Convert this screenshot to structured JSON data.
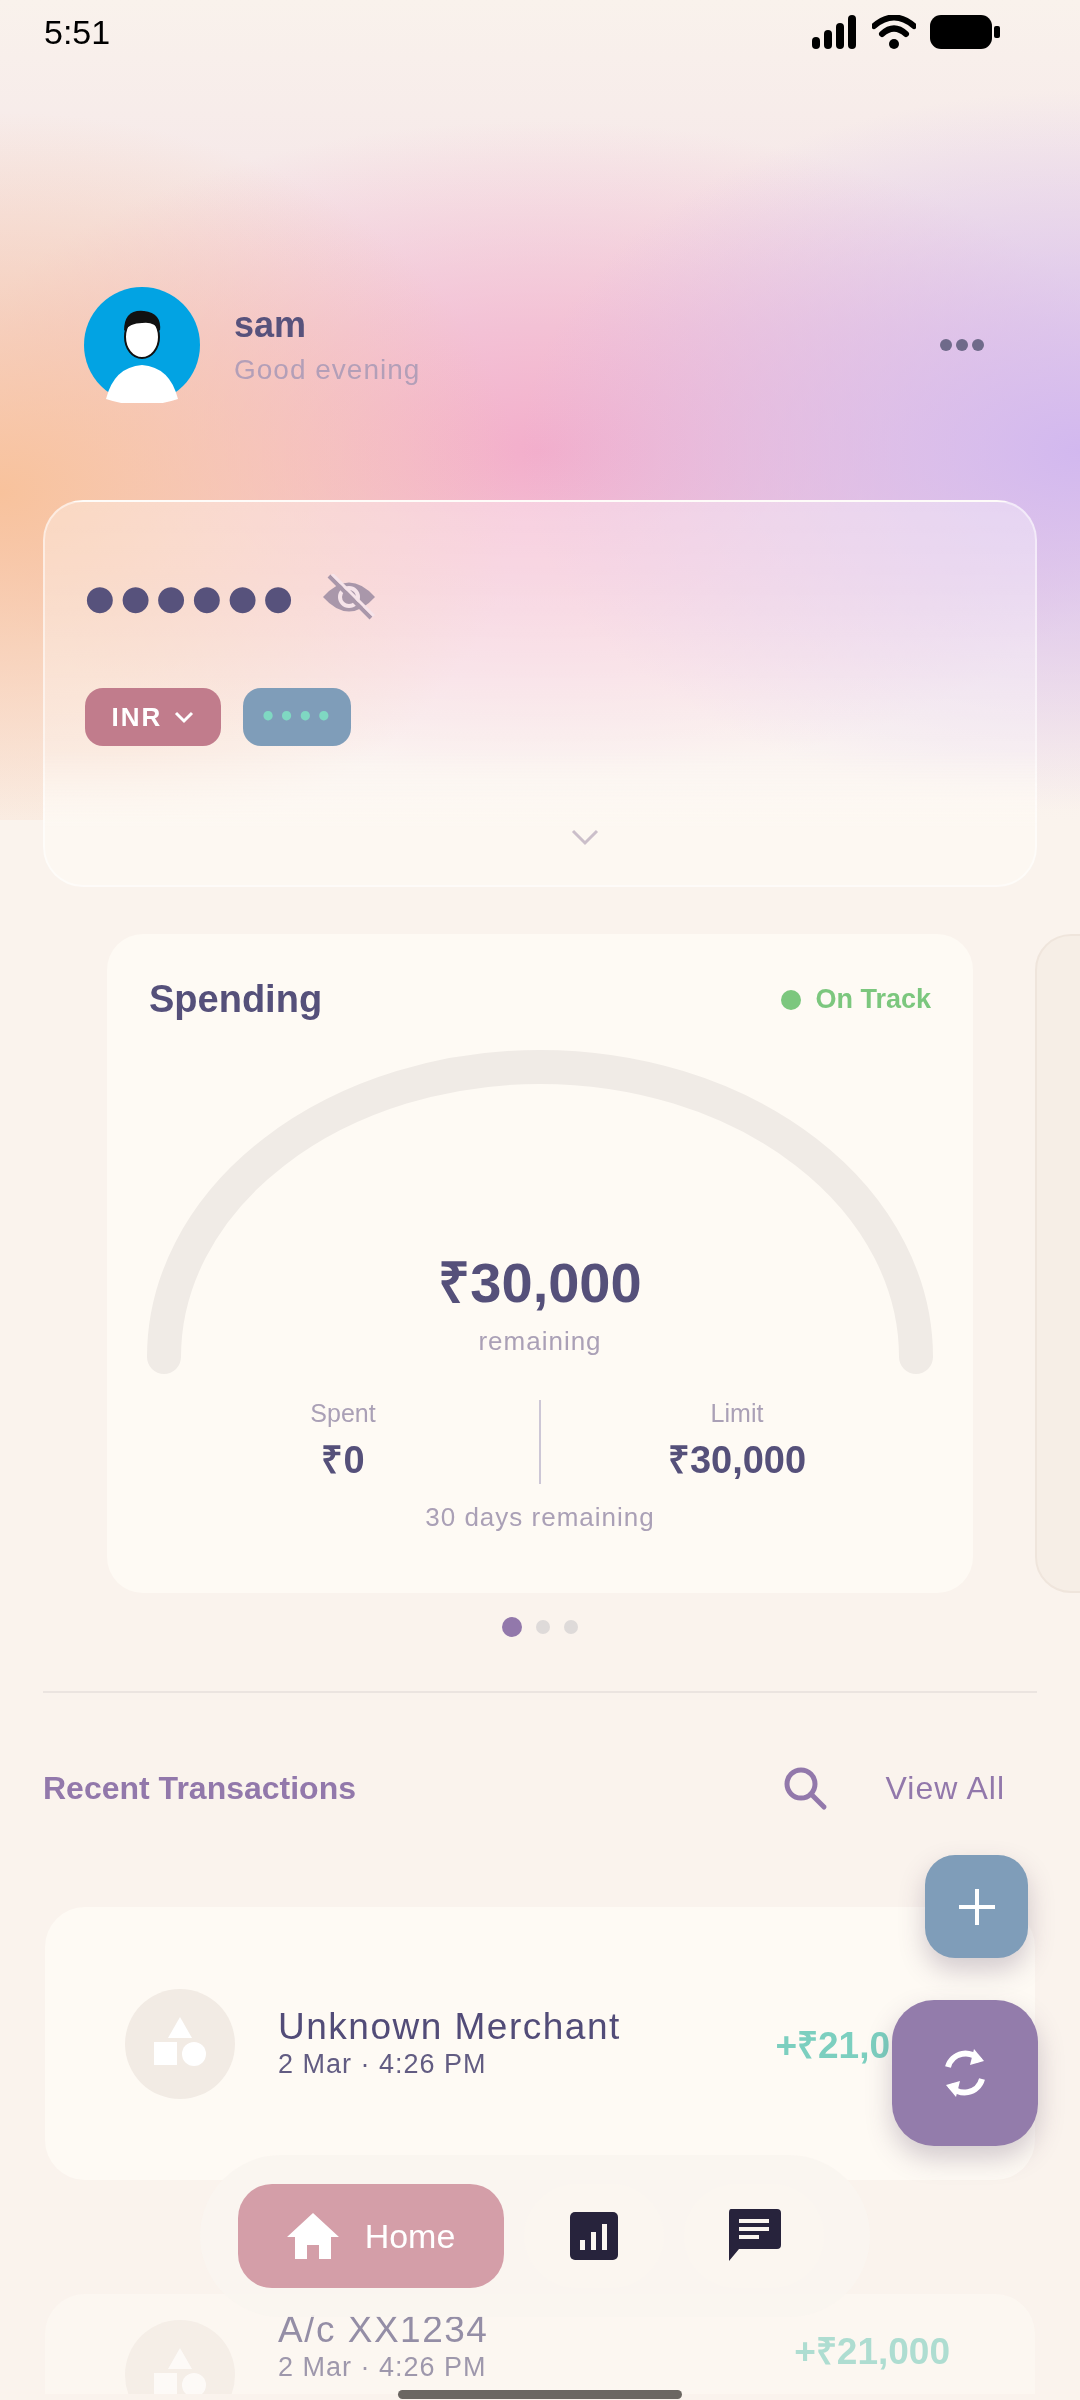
{
  "status_bar": {
    "time": "5:51"
  },
  "profile": {
    "name": "sam",
    "greeting": "Good evening"
  },
  "balance": {
    "masked_value": "●●●●●●",
    "hidden": true,
    "currency": "INR",
    "masked_account": "••••"
  },
  "spending": {
    "title": "Spending",
    "status": {
      "label": "On Track",
      "color": "#7cc77e"
    },
    "amount": "₹30,000",
    "amount_caption": "remaining",
    "spent_label": "Spent",
    "spent": "₹0",
    "limit_label": "Limit",
    "limit": "₹30,000",
    "days_remaining": "30 days remaining"
  },
  "pages": [
    {
      "selected": true
    },
    {
      "selected": false
    },
    {
      "selected": false
    }
  ],
  "transactions_section": {
    "title": "Recent Transactions",
    "view_all": "View All"
  },
  "transactions": [
    {
      "name": "Unknown Merchant",
      "date": "2 Mar · 4:26 PM",
      "amount": "+₹21,0",
      "faded": false
    },
    {
      "name": "A/c XX1234",
      "date": "2 Mar · 4:26 PM",
      "amount": "+₹21,000",
      "faded": true
    }
  ],
  "nav": [
    {
      "kind": "home",
      "label": "Home",
      "selected": true
    },
    {
      "kind": "chart",
      "selected": false
    },
    {
      "kind": "chat",
      "selected": false
    }
  ]
}
